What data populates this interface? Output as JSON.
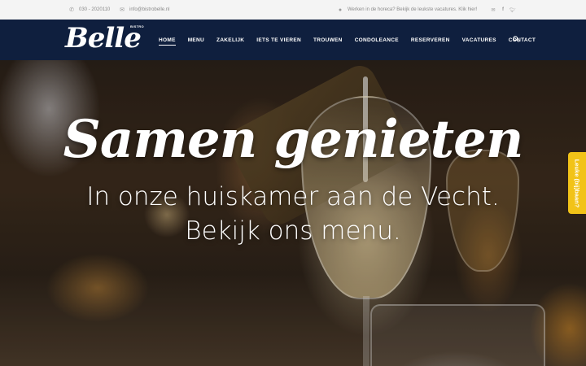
{
  "topbar": {
    "phone": "030 - 2020110",
    "email": "info@bistrobelle.nl",
    "notice": "Werken in de horeca? Bekijk de leukste vacatures. Klik hier!",
    "phone_icon": "phone-icon",
    "email_icon": "envelope-icon",
    "user_icon": "user-icon",
    "social": [
      "email-icon",
      "facebook-icon",
      "twitter-icon"
    ]
  },
  "nav": {
    "logo_text": "Belle",
    "logo_small": "BISTRO",
    "items": [
      "HOME",
      "MENU",
      "ZAKELIJK",
      "IETS TE VIEREN",
      "TROUWEN",
      "CONDOLEANCE",
      "RESERVEREN",
      "VACATURES",
      "CONTACT"
    ],
    "active": "HOME",
    "search_icon": "search-icon"
  },
  "hero": {
    "headline": "Samen genieten",
    "sub_line1": "In onze huiskamer aan de Vecht.",
    "sub_line2": "Bekijk ons menu."
  },
  "side_tab": {
    "label": "Leuke (bij)baan?"
  },
  "colors": {
    "nav_bg": "#0f1f3e",
    "topbar_bg": "#f4f4f4",
    "side_tab": "#f2c318"
  }
}
